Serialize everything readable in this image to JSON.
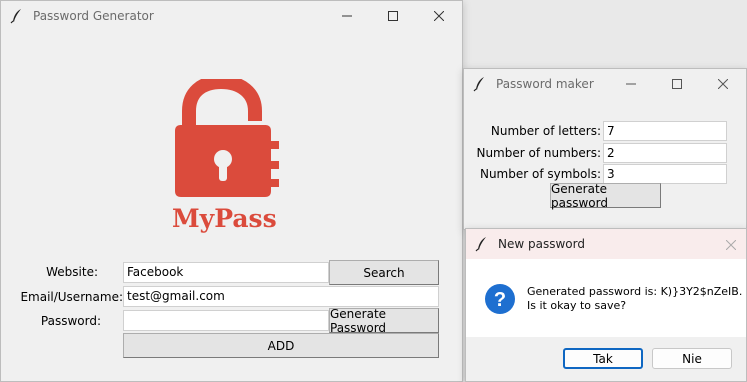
{
  "main_window": {
    "title": "Password Generator",
    "logo_text": "MyPass",
    "website_label": "Website:",
    "website_value": "Facebook",
    "search_label": "Search",
    "email_label": "Email/Username:",
    "email_value": "test@gmail.com",
    "password_label": "Password:",
    "password_value": "",
    "generate_label": "Generate Password",
    "add_label": "ADD"
  },
  "maker_window": {
    "title": "Password maker",
    "letters_label": "Number of letters:",
    "letters_value": "7",
    "numbers_label": "Number of numbers:",
    "numbers_value": "2",
    "symbols_label": "Number of symbols:",
    "symbols_value": "3",
    "generate_label": "Generate password"
  },
  "dialog": {
    "title": "New password",
    "message_line1": "Generated password is: K)}3Y2$nZeIB.",
    "message_line2": "Is it okay to save?",
    "yes_label": "Tak",
    "no_label": "Nie"
  },
  "colors": {
    "logo": "#db4b3c",
    "info_icon": "#1e6fd0"
  }
}
